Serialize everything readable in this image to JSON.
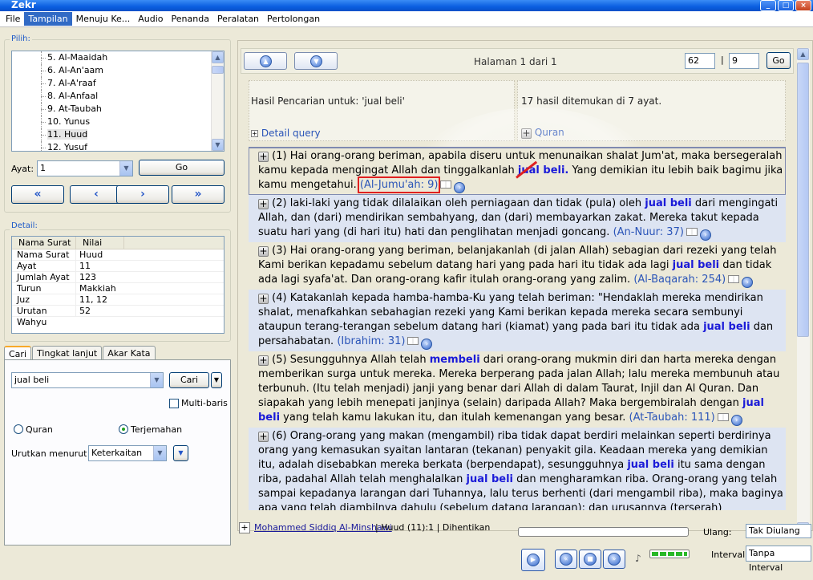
{
  "window": {
    "title": "Zekr"
  },
  "menu": [
    "File",
    "Tampilan",
    "Menuju Ke...",
    "Audio",
    "Penanda",
    "Peralatan",
    "Pertolongan"
  ],
  "pilih": {
    "label": "Pilih:",
    "surahs": [
      "5. Al-Maaidah",
      "6. Al-An'aam",
      "7. Al-A'raaf",
      "8. Al-Anfaal",
      "9. At-Taubah",
      "10. Yunus",
      "11. Huud",
      "12. Yusuf"
    ],
    "selected_index": 6,
    "ayat_label": "Ayat:",
    "ayat_value": "1",
    "go_label": "Go"
  },
  "detail": {
    "label": "Detail:",
    "headers": [
      "Nama Surat",
      "Nilai"
    ],
    "rows": [
      [
        "Nama Surat",
        "Huud"
      ],
      [
        "Ayat",
        "11"
      ],
      [
        "Jumlah Ayat",
        "123"
      ],
      [
        "Turun",
        "Makkiah"
      ],
      [
        "Juz",
        "11, 12"
      ],
      [
        "Urutan Wahyu",
        "52"
      ]
    ]
  },
  "search": {
    "tabs": [
      "Cari",
      "Tingkat lanjut",
      "Akar Kata"
    ],
    "query": "jual beli",
    "cari_label": "Cari",
    "multibaris_label": "Multi-baris",
    "quran_label": "Quran",
    "terjemahan_label": "Terjemahan",
    "urutkan_label": "Urutkan menurut :",
    "urutkan_value": "Keterkaitan"
  },
  "page": {
    "halaman": "Halaman 1 dari 1",
    "input1": "62",
    "input2": "9",
    "go_label": "Go",
    "sep": "|"
  },
  "info": {
    "hasil": "Hasil Pencarian untuk: 'jual beli'",
    "found": "17 hasil ditemukan di 7 ayat.",
    "detail_query": "Detail query",
    "quran": "Quran"
  },
  "results": [
    {
      "num": "(1)",
      "parts": [
        "Hai orang-orang beriman, apabila diseru untuk menunaikan shalat Jum'at, maka bersegeralah kamu kepada mengingat Allah dan tinggalkanlah ",
        "jual beli.",
        " Yang demikian itu lebih baik bagimu jika kamu mengetahui. "
      ],
      "ref": "(Al-Jumu'ah: 9)"
    },
    {
      "num": "(2)",
      "parts": [
        "laki-laki yang tidak dilalaikan oleh perniagaan dan tidak (pula) oleh ",
        "jual beli",
        " dari mengingati Allah, dan (dari) mendirikan sembahyang, dan (dari) membayarkan zakat. Mereka takut kepada suatu hari yang (di hari itu) hati dan penglihatan menjadi goncang. "
      ],
      "ref": "(An-Nuur: 37)"
    },
    {
      "num": "(3)",
      "parts": [
        "Hai orang-orang yang beriman, belanjakanlah (di jalan Allah) sebagian dari rezeki yang telah Kami berikan kepadamu sebelum datang hari yang pada hari itu tidak ada lagi ",
        "jual beli",
        " dan tidak ada lagi syafa'at. Dan orang-orang kafir itulah orang-orang yang zalim. "
      ],
      "ref": "(Al-Baqarah: 254)"
    },
    {
      "num": "(4)",
      "parts": [
        "Katakanlah kepada hamba-hamba-Ku yang telah beriman: \"Hendaklah mereka mendirikan shalat, menafkahkan sebahagian rezeki yang Kami berikan kepada mereka secara sembunyi ataupun terang-terangan sebelum datang hari (kiamat) yang pada bari itu tidak ada ",
        "jual beli",
        " dan persahabatan. "
      ],
      "ref": "(Ibrahim: 31)"
    },
    {
      "num": "(5)",
      "parts": [
        "Sesungguhnya Allah telah ",
        "membeli",
        " dari orang-orang mukmin diri dan harta mereka dengan memberikan surga untuk mereka. Mereka berperang pada jalan Allah; lalu mereka membunuh atau terbunuh. (Itu telah menjadi) janji yang benar dari Allah di dalam Taurat, Injil dan Al Quran. Dan siapakah yang lebih menepati janjinya (selain) daripada Allah? Maka bergembiralah dengan ",
        "jual beli",
        " yang telah kamu lakukan itu, dan itulah kemenangan yang besar. "
      ],
      "ref": "(At-Taubah: 111)"
    },
    {
      "num": "(6)",
      "parts": [
        "Orang-orang yang makan (mengambil) riba tidak dapat berdiri melainkan seperti berdirinya orang yang kemasukan syaitan lantaran (tekanan) penyakit gila. Keadaan mereka yang demikian itu, adalah disebabkan mereka berkata (berpendapat), sesungguhnya ",
        "jual beli",
        " itu sama dengan riba, padahal Allah telah menghalalkan ",
        "jual beli",
        " dan mengharamkan riba. Orang-orang yang telah sampai kepadanya larangan dari Tuhannya, lalu terus berhenti (dari mengambil riba), maka baginya apa yang telah diambilnya dahulu (sebelum datang larangan); dan urusannya (terserah)"
      ],
      "ref": ""
    }
  ],
  "audio": {
    "reciter": "Mohammed Siddiq Al-Minshawi",
    "status": "| Huud (11):1 | Dihentikan",
    "ulang_label": "Ulang:",
    "ulang_value": "Tak Diulang",
    "interval_label": "Interval:",
    "interval_value": "Tanpa Interval"
  }
}
